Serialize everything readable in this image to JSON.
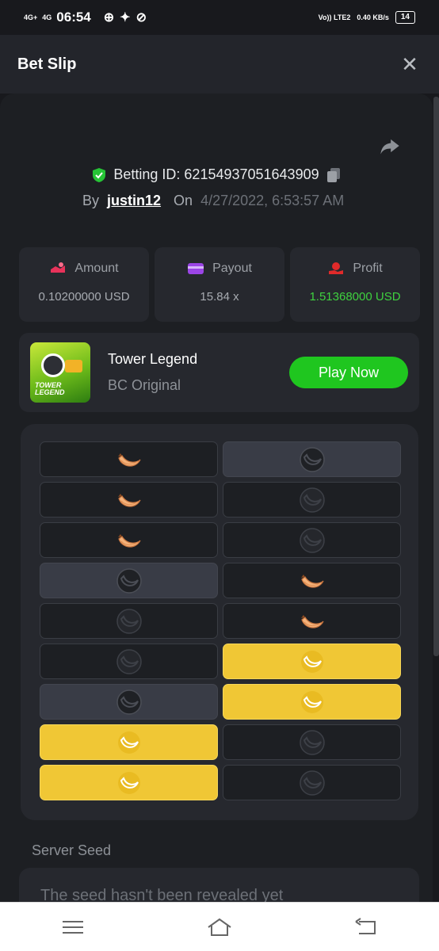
{
  "status_bar": {
    "network_left": "4G+",
    "network_right": "4G",
    "time": "06:54",
    "volte": "Vo)) LTE2",
    "speed": "0.40 KB/s",
    "battery": "14"
  },
  "header": {
    "title": "Bet Slip"
  },
  "bet": {
    "betting_id": "Betting ID: 62154937051643909",
    "by_label": "By",
    "user": "justin12",
    "on_label": "On",
    "date": "4/27/2022, 6:53:57 AM"
  },
  "stats": {
    "amount_label": "Amount",
    "amount_value": "0.10200000 USD",
    "payout_label": "Payout",
    "payout_value": "15.84 x",
    "profit_label": "Profit",
    "profit_value": "1.51368000 USD"
  },
  "game": {
    "name": "Tower Legend",
    "subtitle": "BC Original",
    "thumb_text": "TOWER LEGEND",
    "play_label": "Play Now"
  },
  "board": {
    "rows": [
      [
        "banana",
        "grey"
      ],
      [
        "banana",
        "dark"
      ],
      [
        "banana",
        "dark"
      ],
      [
        "grey",
        "banana"
      ],
      [
        "dark",
        "banana"
      ],
      [
        "dark",
        "gold"
      ],
      [
        "grey",
        "gold"
      ],
      [
        "gold",
        "dark"
      ],
      [
        "gold",
        "dark"
      ]
    ]
  },
  "seed": {
    "label": "Server Seed",
    "text": "The seed hasn't been revealed yet"
  },
  "colors": {
    "accent_green": "#1fc61f",
    "profit_green": "#3fd13f",
    "gold": "#f0c735"
  }
}
